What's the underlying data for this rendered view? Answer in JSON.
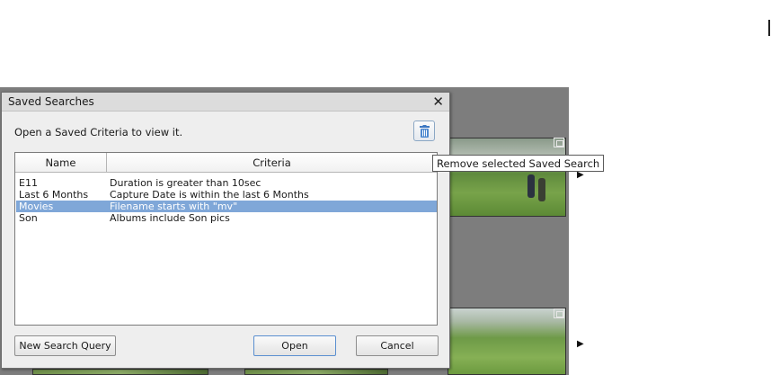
{
  "background": {
    "area_color": "#7d7d7d",
    "thumbnail_icons": [
      "filmstrip-icon",
      "play-arrow-icon"
    ]
  },
  "tooltip": {
    "text": "Remove selected Saved Search"
  },
  "dialog": {
    "title": "Saved Searches",
    "close_label": "✕",
    "instruction": "Open a Saved Criteria to view it.",
    "delete_icon": "trash-icon",
    "table": {
      "columns": [
        "Name",
        "Criteria"
      ],
      "rows": [
        {
          "name": "E11",
          "criteria": "Duration is greater than 10sec",
          "selected": false
        },
        {
          "name": "Last 6 Months",
          "criteria": "Capture Date is within the last 6 Months",
          "selected": false
        },
        {
          "name": "Movies",
          "criteria": "Filename starts with \"mv\"",
          "selected": true
        },
        {
          "name": "Son",
          "criteria": "Albums include Son pics",
          "selected": false
        }
      ],
      "selection_color": "#7fa7d8"
    },
    "buttons": {
      "new_query": "New Search Query",
      "open": "Open",
      "cancel": "Cancel"
    }
  }
}
